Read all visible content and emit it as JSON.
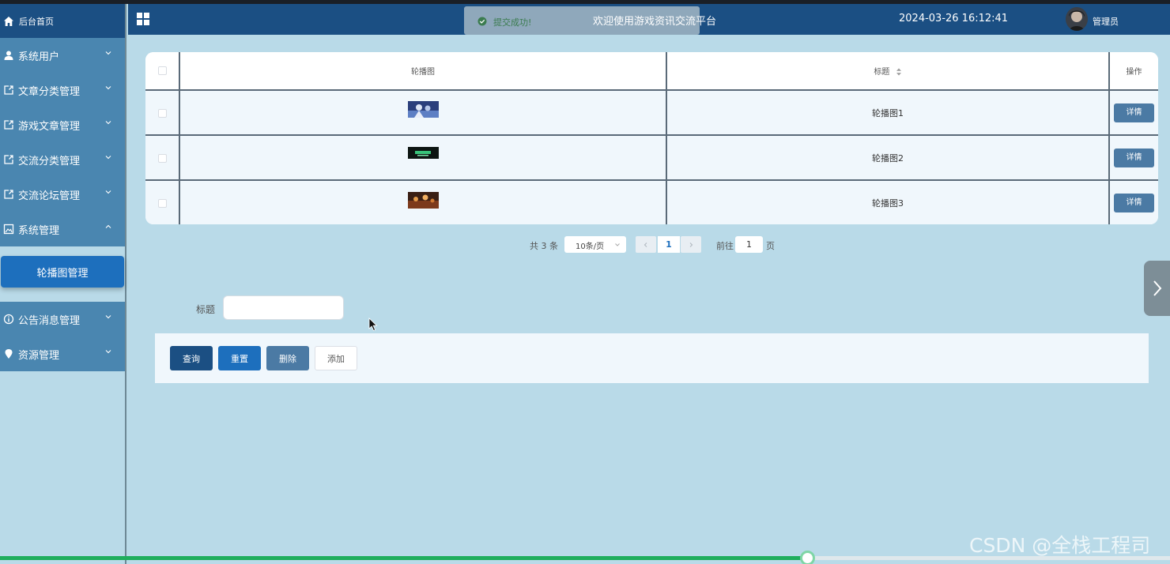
{
  "header": {
    "welcome": "欢迎使用游戏资讯交流平台",
    "datetime": "2024-03-26 16:12:41",
    "user": "管理员",
    "toast": "提交成功!"
  },
  "sidebar": {
    "home": "后台首页",
    "items": [
      {
        "label": "系统用户",
        "icon": "user-icon"
      },
      {
        "label": "文章分类管理",
        "icon": "external-link-icon"
      },
      {
        "label": "游戏文章管理",
        "icon": "external-link-icon"
      },
      {
        "label": "交流分类管理",
        "icon": "external-link-icon"
      },
      {
        "label": "交流论坛管理",
        "icon": "external-link-icon"
      },
      {
        "label": "系统管理",
        "icon": "picture-icon",
        "expanded": true
      },
      {
        "label": "公告消息管理",
        "icon": "info-icon"
      },
      {
        "label": "资源管理",
        "icon": "location-pin-icon"
      }
    ],
    "sub_item": "轮播图管理"
  },
  "table": {
    "headers": [
      "轮播图",
      "标题",
      "操作"
    ],
    "rows": [
      {
        "title": "轮播图1",
        "action": "详情"
      },
      {
        "title": "轮播图2",
        "action": "详情"
      },
      {
        "title": "轮播图3",
        "action": "详情"
      }
    ]
  },
  "pagination": {
    "total": "共 3 条",
    "page_size": "10条/页",
    "current": "1",
    "goto_prefix": "前往",
    "goto_value": "1",
    "goto_suffix": "页"
  },
  "search": {
    "label": "标题",
    "placeholder": ""
  },
  "actions": {
    "query": "查询",
    "reset": "重置",
    "delete": "删除",
    "add": "添加"
  },
  "progress": {
    "fraction": 0.69
  },
  "watermark": "CSDN @全栈工程司",
  "colors": {
    "primary": "#1b4f83",
    "accent": "#1d6fbd",
    "menu": "#4a86b0",
    "background": "#b9dae8",
    "success": "#1fae5d"
  }
}
